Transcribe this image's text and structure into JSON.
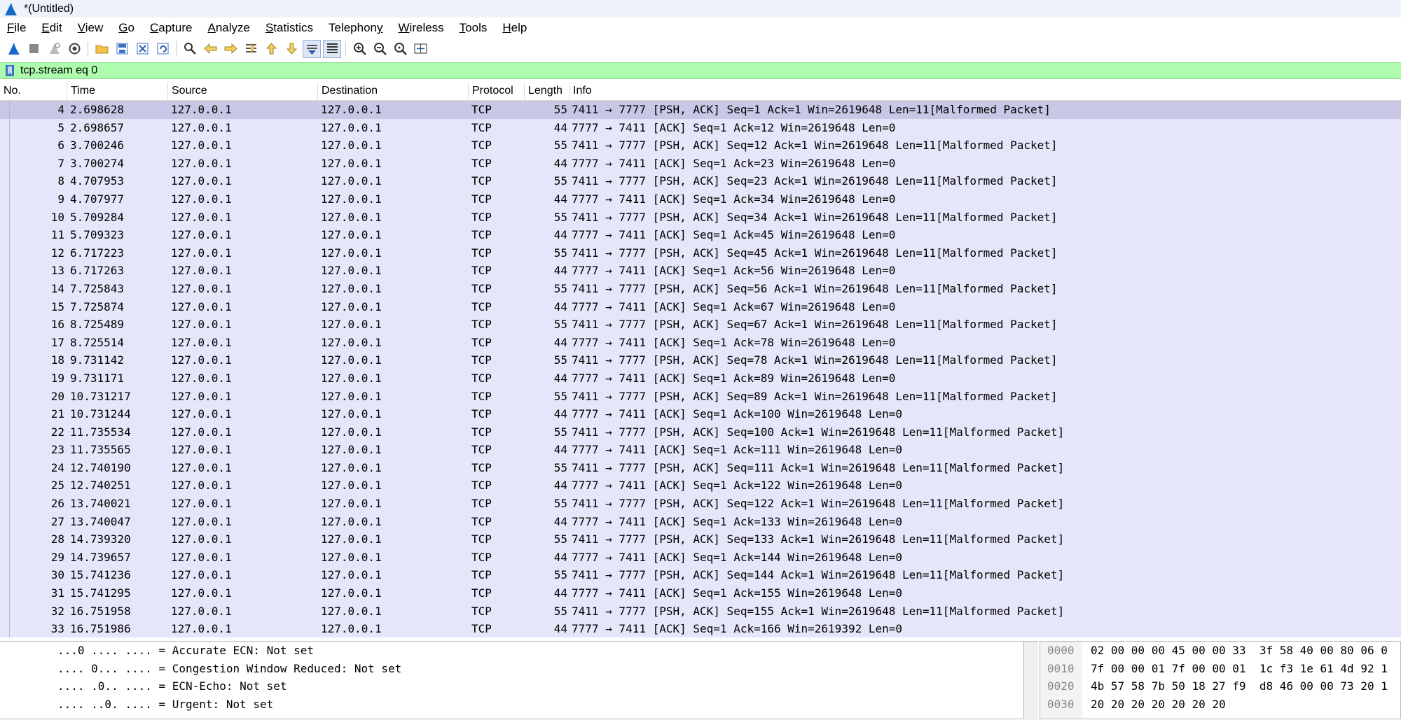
{
  "window": {
    "title": "*(Untitled)"
  },
  "menu": [
    {
      "pre": "",
      "mn": "F",
      "post": "ile"
    },
    {
      "pre": "",
      "mn": "E",
      "post": "dit"
    },
    {
      "pre": "",
      "mn": "V",
      "post": "iew"
    },
    {
      "pre": "",
      "mn": "G",
      "post": "o"
    },
    {
      "pre": "",
      "mn": "C",
      "post": "apture"
    },
    {
      "pre": "",
      "mn": "A",
      "post": "nalyze"
    },
    {
      "pre": "",
      "mn": "S",
      "post": "tatistics"
    },
    {
      "pre": "Telephon",
      "mn": "y",
      "post": ""
    },
    {
      "pre": "",
      "mn": "W",
      "post": "ireless"
    },
    {
      "pre": "",
      "mn": "T",
      "post": "ools"
    },
    {
      "pre": "",
      "mn": "H",
      "post": "elp"
    }
  ],
  "toolbar_icons": [
    "start-capture-icon",
    "stop-capture-icon",
    "restart-capture-icon",
    "capture-options-icon",
    "open-file-icon",
    "save-file-icon",
    "close-file-icon",
    "reload-file-icon",
    "find-packet-icon",
    "go-back-icon",
    "go-forward-icon",
    "go-to-packet-icon",
    "first-packet-icon",
    "last-packet-icon",
    "autoscroll-icon",
    "colorize-icon",
    "zoom-in-icon",
    "zoom-out-icon",
    "normal-size-icon",
    "resize-columns-icon"
  ],
  "filter": {
    "value": "tcp.stream eq 0"
  },
  "columns": {
    "no": "No.",
    "time": "Time",
    "source": "Source",
    "destination": "Destination",
    "protocol": "Protocol",
    "length": "Length",
    "info": "Info"
  },
  "packets": [
    {
      "no": "4",
      "time": "2.698628",
      "src": "127.0.0.1",
      "dst": "127.0.0.1",
      "proto": "TCP",
      "len": "55",
      "info": "7411 → 7777 [PSH, ACK] Seq=1 Ack=1 Win=2619648 Len=11[Malformed Packet]"
    },
    {
      "no": "5",
      "time": "2.698657",
      "src": "127.0.0.1",
      "dst": "127.0.0.1",
      "proto": "TCP",
      "len": "44",
      "info": "7777 → 7411 [ACK] Seq=1 Ack=12 Win=2619648 Len=0"
    },
    {
      "no": "6",
      "time": "3.700246",
      "src": "127.0.0.1",
      "dst": "127.0.0.1",
      "proto": "TCP",
      "len": "55",
      "info": "7411 → 7777 [PSH, ACK] Seq=12 Ack=1 Win=2619648 Len=11[Malformed Packet]"
    },
    {
      "no": "7",
      "time": "3.700274",
      "src": "127.0.0.1",
      "dst": "127.0.0.1",
      "proto": "TCP",
      "len": "44",
      "info": "7777 → 7411 [ACK] Seq=1 Ack=23 Win=2619648 Len=0"
    },
    {
      "no": "8",
      "time": "4.707953",
      "src": "127.0.0.1",
      "dst": "127.0.0.1",
      "proto": "TCP",
      "len": "55",
      "info": "7411 → 7777 [PSH, ACK] Seq=23 Ack=1 Win=2619648 Len=11[Malformed Packet]"
    },
    {
      "no": "9",
      "time": "4.707977",
      "src": "127.0.0.1",
      "dst": "127.0.0.1",
      "proto": "TCP",
      "len": "44",
      "info": "7777 → 7411 [ACK] Seq=1 Ack=34 Win=2619648 Len=0"
    },
    {
      "no": "10",
      "time": "5.709284",
      "src": "127.0.0.1",
      "dst": "127.0.0.1",
      "proto": "TCP",
      "len": "55",
      "info": "7411 → 7777 [PSH, ACK] Seq=34 Ack=1 Win=2619648 Len=11[Malformed Packet]"
    },
    {
      "no": "11",
      "time": "5.709323",
      "src": "127.0.0.1",
      "dst": "127.0.0.1",
      "proto": "TCP",
      "len": "44",
      "info": "7777 → 7411 [ACK] Seq=1 Ack=45 Win=2619648 Len=0"
    },
    {
      "no": "12",
      "time": "6.717223",
      "src": "127.0.0.1",
      "dst": "127.0.0.1",
      "proto": "TCP",
      "len": "55",
      "info": "7411 → 7777 [PSH, ACK] Seq=45 Ack=1 Win=2619648 Len=11[Malformed Packet]"
    },
    {
      "no": "13",
      "time": "6.717263",
      "src": "127.0.0.1",
      "dst": "127.0.0.1",
      "proto": "TCP",
      "len": "44",
      "info": "7777 → 7411 [ACK] Seq=1 Ack=56 Win=2619648 Len=0"
    },
    {
      "no": "14",
      "time": "7.725843",
      "src": "127.0.0.1",
      "dst": "127.0.0.1",
      "proto": "TCP",
      "len": "55",
      "info": "7411 → 7777 [PSH, ACK] Seq=56 Ack=1 Win=2619648 Len=11[Malformed Packet]"
    },
    {
      "no": "15",
      "time": "7.725874",
      "src": "127.0.0.1",
      "dst": "127.0.0.1",
      "proto": "TCP",
      "len": "44",
      "info": "7777 → 7411 [ACK] Seq=1 Ack=67 Win=2619648 Len=0"
    },
    {
      "no": "16",
      "time": "8.725489",
      "src": "127.0.0.1",
      "dst": "127.0.0.1",
      "proto": "TCP",
      "len": "55",
      "info": "7411 → 7777 [PSH, ACK] Seq=67 Ack=1 Win=2619648 Len=11[Malformed Packet]"
    },
    {
      "no": "17",
      "time": "8.725514",
      "src": "127.0.0.1",
      "dst": "127.0.0.1",
      "proto": "TCP",
      "len": "44",
      "info": "7777 → 7411 [ACK] Seq=1 Ack=78 Win=2619648 Len=0"
    },
    {
      "no": "18",
      "time": "9.731142",
      "src": "127.0.0.1",
      "dst": "127.0.0.1",
      "proto": "TCP",
      "len": "55",
      "info": "7411 → 7777 [PSH, ACK] Seq=78 Ack=1 Win=2619648 Len=11[Malformed Packet]"
    },
    {
      "no": "19",
      "time": "9.731171",
      "src": "127.0.0.1",
      "dst": "127.0.0.1",
      "proto": "TCP",
      "len": "44",
      "info": "7777 → 7411 [ACK] Seq=1 Ack=89 Win=2619648 Len=0"
    },
    {
      "no": "20",
      "time": "10.731217",
      "src": "127.0.0.1",
      "dst": "127.0.0.1",
      "proto": "TCP",
      "len": "55",
      "info": "7411 → 7777 [PSH, ACK] Seq=89 Ack=1 Win=2619648 Len=11[Malformed Packet]"
    },
    {
      "no": "21",
      "time": "10.731244",
      "src": "127.0.0.1",
      "dst": "127.0.0.1",
      "proto": "TCP",
      "len": "44",
      "info": "7777 → 7411 [ACK] Seq=1 Ack=100 Win=2619648 Len=0"
    },
    {
      "no": "22",
      "time": "11.735534",
      "src": "127.0.0.1",
      "dst": "127.0.0.1",
      "proto": "TCP",
      "len": "55",
      "info": "7411 → 7777 [PSH, ACK] Seq=100 Ack=1 Win=2619648 Len=11[Malformed Packet]"
    },
    {
      "no": "23",
      "time": "11.735565",
      "src": "127.0.0.1",
      "dst": "127.0.0.1",
      "proto": "TCP",
      "len": "44",
      "info": "7777 → 7411 [ACK] Seq=1 Ack=111 Win=2619648 Len=0"
    },
    {
      "no": "24",
      "time": "12.740190",
      "src": "127.0.0.1",
      "dst": "127.0.0.1",
      "proto": "TCP",
      "len": "55",
      "info": "7411 → 7777 [PSH, ACK] Seq=111 Ack=1 Win=2619648 Len=11[Malformed Packet]"
    },
    {
      "no": "25",
      "time": "12.740251",
      "src": "127.0.0.1",
      "dst": "127.0.0.1",
      "proto": "TCP",
      "len": "44",
      "info": "7777 → 7411 [ACK] Seq=1 Ack=122 Win=2619648 Len=0"
    },
    {
      "no": "26",
      "time": "13.740021",
      "src": "127.0.0.1",
      "dst": "127.0.0.1",
      "proto": "TCP",
      "len": "55",
      "info": "7411 → 7777 [PSH, ACK] Seq=122 Ack=1 Win=2619648 Len=11[Malformed Packet]"
    },
    {
      "no": "27",
      "time": "13.740047",
      "src": "127.0.0.1",
      "dst": "127.0.0.1",
      "proto": "TCP",
      "len": "44",
      "info": "7777 → 7411 [ACK] Seq=1 Ack=133 Win=2619648 Len=0"
    },
    {
      "no": "28",
      "time": "14.739320",
      "src": "127.0.0.1",
      "dst": "127.0.0.1",
      "proto": "TCP",
      "len": "55",
      "info": "7411 → 7777 [PSH, ACK] Seq=133 Ack=1 Win=2619648 Len=11[Malformed Packet]"
    },
    {
      "no": "29",
      "time": "14.739657",
      "src": "127.0.0.1",
      "dst": "127.0.0.1",
      "proto": "TCP",
      "len": "44",
      "info": "7777 → 7411 [ACK] Seq=1 Ack=144 Win=2619648 Len=0"
    },
    {
      "no": "30",
      "time": "15.741236",
      "src": "127.0.0.1",
      "dst": "127.0.0.1",
      "proto": "TCP",
      "len": "55",
      "info": "7411 → 7777 [PSH, ACK] Seq=144 Ack=1 Win=2619648 Len=11[Malformed Packet]"
    },
    {
      "no": "31",
      "time": "15.741295",
      "src": "127.0.0.1",
      "dst": "127.0.0.1",
      "proto": "TCP",
      "len": "44",
      "info": "7777 → 7411 [ACK] Seq=1 Ack=155 Win=2619648 Len=0"
    },
    {
      "no": "32",
      "time": "16.751958",
      "src": "127.0.0.1",
      "dst": "127.0.0.1",
      "proto": "TCP",
      "len": "55",
      "info": "7411 → 7777 [PSH, ACK] Seq=155 Ack=1 Win=2619648 Len=11[Malformed Packet]"
    },
    {
      "no": "33",
      "time": "16.751986",
      "src": "127.0.0.1",
      "dst": "127.0.0.1",
      "proto": "TCP",
      "len": "44",
      "info": "7777 → 7411 [ACK] Seq=1 Ack=166 Win=2619392 Len=0"
    }
  ],
  "details": [
    "...0 .... .... = Accurate ECN: Not set",
    ".... 0... .... = Congestion Window Reduced: Not set",
    ".... .0.. .... = ECN-Echo: Not set",
    ".... ..0. .... = Urgent: Not set"
  ],
  "bytes": [
    {
      "offset": "0000",
      "hex": "02 00 00 00 45 00 00 33  3f 58 40 00 80 06 0"
    },
    {
      "offset": "0010",
      "hex": "7f 00 00 01 7f 00 00 01  1c f3 1e 61 4d 92 1"
    },
    {
      "offset": "0020",
      "hex": "4b 57 58 7b 50 18 27 f9  d8 46 00 00 73 20 1"
    },
    {
      "offset": "0030",
      "hex": "20 20 20 20 20 20 20"
    }
  ],
  "colors": {
    "row_bg": "#e6e6fa",
    "row_selected": "#c9c7e6",
    "filter_valid": "#aefcae",
    "titlebar_bg": "#eef2fb"
  }
}
